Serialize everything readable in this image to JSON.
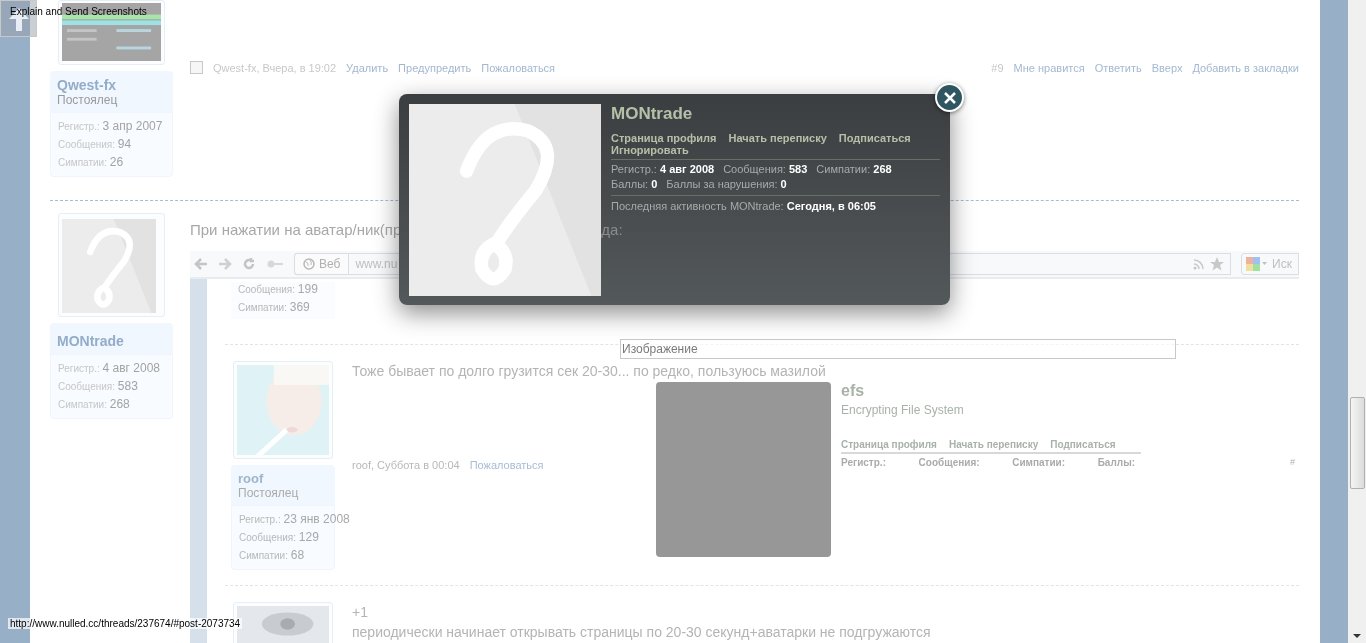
{
  "capture_tool": {
    "label": "Explain and Send Screenshots"
  },
  "status_url": "http://www.nulled.cc/threads/237674/#post-2073734",
  "posts": [
    {
      "avatar": {
        "kind": "picture"
      },
      "user": {
        "name": "Qwest-fx",
        "title": "Постоялец",
        "stats": [
          {
            "label": "Регистр.:",
            "value": "3 апр 2007"
          },
          {
            "label": "Сообщения:",
            "value": "94"
          },
          {
            "label": "Симпатии:",
            "value": "26"
          }
        ]
      },
      "footer": {
        "checked": false,
        "author_date": "Qwest-fx, Вчера, в 19:02",
        "actions": [
          "Удалить",
          "Предупредить",
          "Пожаловаться"
        ],
        "number": "#9",
        "right_actions": [
          "Мне нравится",
          "Ответить",
          "Вверх",
          "Добавить в закладки"
        ]
      }
    },
    {
      "avatar": {
        "kind": "placeholder"
      },
      "user": {
        "name": "MONtrade",
        "stats": [
          {
            "label": "Регистр.:",
            "value": "4 авг 2008"
          },
          {
            "label": "Сообщения:",
            "value": "583"
          },
          {
            "label": "Симпатии:",
            "value": "268"
          }
        ]
      },
      "message_parts": [
        "При нажатии на аватар/ник(пр",
        "да:"
      ],
      "screenshot": {
        "toolbar": {
          "search_engine": "Веб",
          "address": "www.nu",
          "search_placeholder": "Иск"
        },
        "partial_stats": [
          {
            "label": "Сообщения:",
            "value": "199"
          },
          {
            "label": "Симпатии:",
            "value": "369"
          }
        ],
        "posts": [
          {
            "avatar": {
              "kind": "picture"
            },
            "user": {
              "name": "roof",
              "title": "Постоялец",
              "stats": [
                {
                  "label": "Регистр.:",
                  "value": "23 янв 2008"
                },
                {
                  "label": "Сообщения:",
                  "value": "129"
                },
                {
                  "label": "Симпатии:",
                  "value": "68"
                }
              ]
            },
            "message_lines": [
              "Тоже бывает по долго грузится сек 20-30... по редко, пользуюсь мазилой"
            ],
            "footer": {
              "author_date": "roof, Суббота в 00:04",
              "actions": [
                "Пожаловаться"
              ]
            }
          },
          {
            "avatar": {
              "kind": "picture"
            },
            "message_lines": [
              "+1",
              "периодически начинает открывать страницы по 20-30 секунд+аватарки не подгружаются"
            ]
          }
        ],
        "image_tooltip": "Изображение",
        "mini_profile": {
          "name": "efs",
          "title": "Encrypting File System",
          "links": [
            "Страница профиля",
            "Начать переписку",
            "Подписаться"
          ],
          "stat_labels": [
            "Регистр.:",
            "Сообщения:",
            "Симпатии:",
            "Баллы:"
          ]
        },
        "hash": "#"
      }
    }
  ],
  "profile_popup": {
    "name": "MONtrade",
    "links": [
      "Страница профиля",
      "Начать переписку",
      "Подписаться",
      "Игнорировать"
    ],
    "stats": [
      {
        "label": "Регистр.:",
        "value": "4 авг 2008"
      },
      {
        "label": "Сообщения:",
        "value": "583"
      },
      {
        "label": "Симпатии:",
        "value": "268"
      },
      {
        "label": "Баллы:",
        "value": "0"
      },
      {
        "label": "Баллы за нарушения:",
        "value": "0"
      }
    ],
    "activity": {
      "label": "Последняя активность MONtrade:",
      "value": "Сегодня, в 06:05"
    }
  }
}
